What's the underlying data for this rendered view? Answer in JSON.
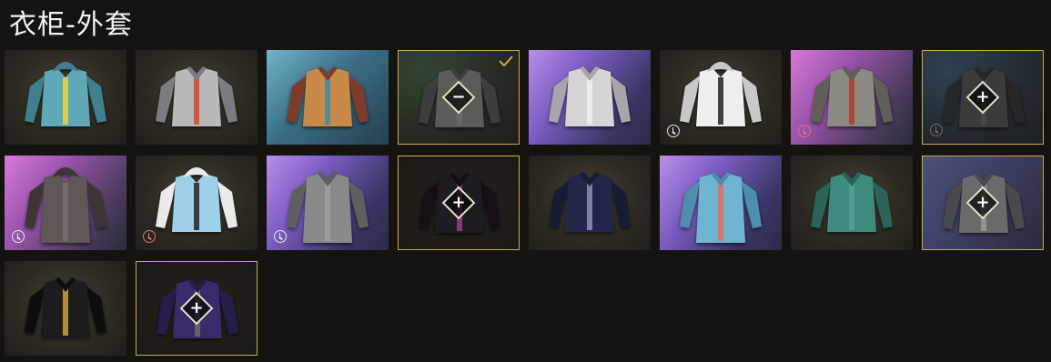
{
  "header": {
    "title": "衣柜-外套"
  },
  "colors": {
    "selected_border": "#c9a94f",
    "expiry_red": "#e87070"
  },
  "items": [
    {
      "id": "hoodie-teal",
      "bg": "bg-dark",
      "style": "teal-hoodie",
      "state": "normal",
      "timed": false
    },
    {
      "id": "silver-jacket-red",
      "bg": "bg-dark",
      "style": "silver-red",
      "state": "normal",
      "timed": false
    },
    {
      "id": "pattern-shirt",
      "bg": "bg-teal",
      "style": "pattern",
      "state": "normal",
      "timed": false
    },
    {
      "id": "equipped-jacket",
      "bg": "bg-green",
      "style": "grey-jacket",
      "state": "equipped",
      "timed": false,
      "action": "−"
    },
    {
      "id": "metallic-jacket",
      "bg": "bg-purple",
      "style": "metallic",
      "state": "normal",
      "timed": false
    },
    {
      "id": "white-hoodie",
      "bg": "bg-dark",
      "style": "white-hoodie",
      "state": "normal",
      "timed": true,
      "clock": "white"
    },
    {
      "id": "bomber-pink",
      "bg": "bg-pink",
      "style": "bomber",
      "state": "normal",
      "timed": true,
      "clock": "red"
    },
    {
      "id": "dark-jacket-add",
      "bg": "bg-navy",
      "style": "dark-jacket",
      "state": "add",
      "timed": true,
      "clock": "dim",
      "action": "+"
    },
    {
      "id": "hooded-cloak",
      "bg": "bg-pink",
      "style": "cloak",
      "state": "normal",
      "timed": true,
      "clock": "white"
    },
    {
      "id": "blue-white-hoodie",
      "bg": "bg-dark",
      "style": "blue-hoodie",
      "state": "normal",
      "timed": true,
      "clock": "red"
    },
    {
      "id": "long-coat",
      "bg": "bg-purple",
      "style": "long-coat",
      "state": "normal",
      "timed": true,
      "clock": "white"
    },
    {
      "id": "black-pink-add",
      "bg": "bg-empty",
      "style": "black-pink",
      "state": "add",
      "timed": false,
      "action": "+"
    },
    {
      "id": "navy-sweater",
      "bg": "bg-dark",
      "style": "navy-sweater",
      "state": "normal",
      "timed": false
    },
    {
      "id": "blue-jumpsuit",
      "bg": "bg-purple",
      "style": "jumpsuit",
      "state": "normal",
      "timed": false
    },
    {
      "id": "green-shirt",
      "bg": "bg-dark",
      "style": "green-shirt",
      "state": "normal",
      "timed": false
    },
    {
      "id": "grey-jacket-add",
      "bg": "bg-violet",
      "style": "grey-check",
      "state": "add",
      "timed": false,
      "action": "+"
    },
    {
      "id": "gold-black-jacket",
      "bg": "bg-dark",
      "style": "gold-black",
      "state": "normal",
      "timed": false
    },
    {
      "id": "purple-jacket-add",
      "bg": "bg-empty",
      "style": "purple",
      "state": "add",
      "timed": false,
      "action": "+"
    }
  ]
}
